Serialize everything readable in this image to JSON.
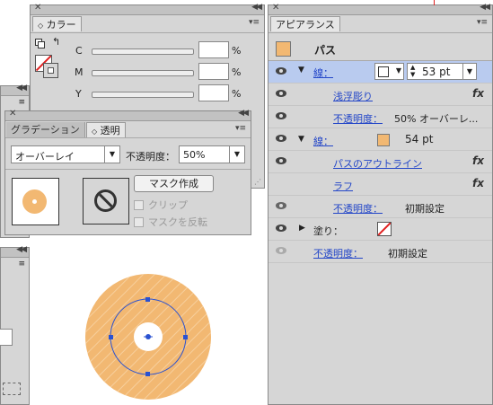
{
  "color_panel": {
    "tab": "カラー",
    "channels": [
      {
        "label": "C",
        "value": "",
        "unit": "%"
      },
      {
        "label": "M",
        "value": "",
        "unit": "%"
      },
      {
        "label": "Y",
        "value": "",
        "unit": "%"
      }
    ]
  },
  "gradient_panel": {
    "tabs": [
      "グラデーション",
      "透明"
    ],
    "blend_mode": "オーバーレイ",
    "opacity_label": "不透明度：",
    "opacity_value": "50%",
    "make_mask": "マスク作成",
    "clip_label": "クリップ",
    "invert_label": "マスクを反転"
  },
  "appearance_panel": {
    "tab": "アピアランス",
    "title": "パス",
    "rows": [
      {
        "kind": "stroke1",
        "label": "線：",
        "weight": "53 pt"
      },
      {
        "kind": "effect",
        "label": "浅浮彫り",
        "fx": "fx"
      },
      {
        "kind": "opacity",
        "label": "不透明度：",
        "value": "50% オーバーレ..."
      },
      {
        "kind": "stroke2",
        "label": "線：",
        "weight": "54 pt"
      },
      {
        "kind": "effect",
        "label": "パスのアウトライン",
        "fx": "fx"
      },
      {
        "kind": "effect",
        "label": "ラフ",
        "fx": "fx"
      },
      {
        "kind": "opacity",
        "label": "不透明度：",
        "value": "初期設定"
      },
      {
        "kind": "fill",
        "label": "塗り："
      },
      {
        "kind": "opacity-top",
        "label": "不透明度：",
        "value": "初期設定"
      }
    ]
  },
  "colors": {
    "panel_bg": "#d6d6d6",
    "highlight_row": "#b9cbef",
    "orange": "#f2b872",
    "link": "#2346c8",
    "selection": "#2a52d1"
  }
}
